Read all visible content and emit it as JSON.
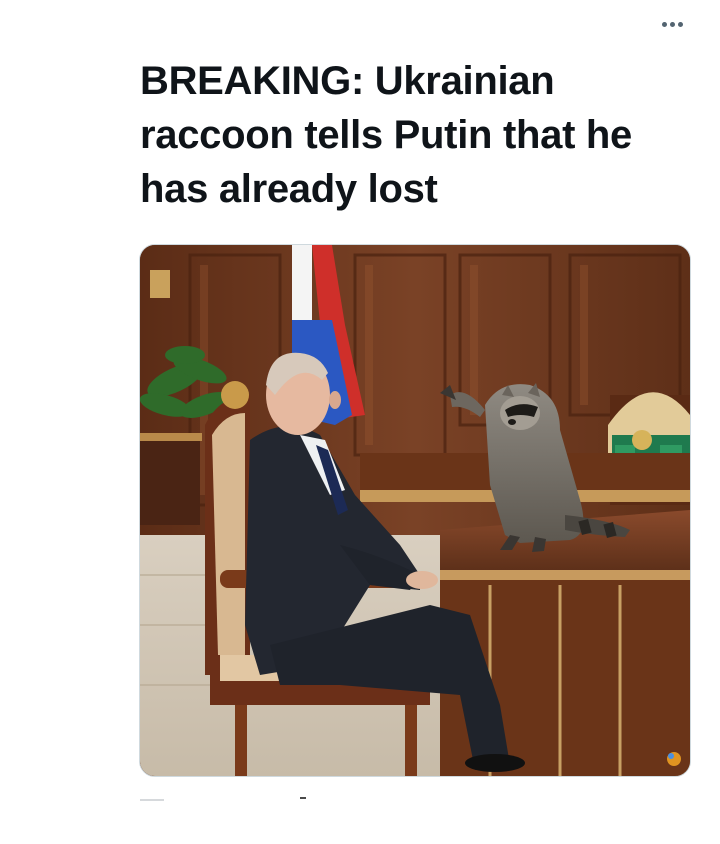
{
  "tweet": {
    "text_part1": "BREAKING: Ukrainian raccoon tells ",
    "text_bold": "Putin",
    "text_part2": " that he has already lost",
    "more_icon": "more-horizontal-icon"
  },
  "media": {
    "type": "photo"
  },
  "colors": {
    "text": "#0f1419",
    "icon": "#536471",
    "border": "#cfd9de"
  }
}
